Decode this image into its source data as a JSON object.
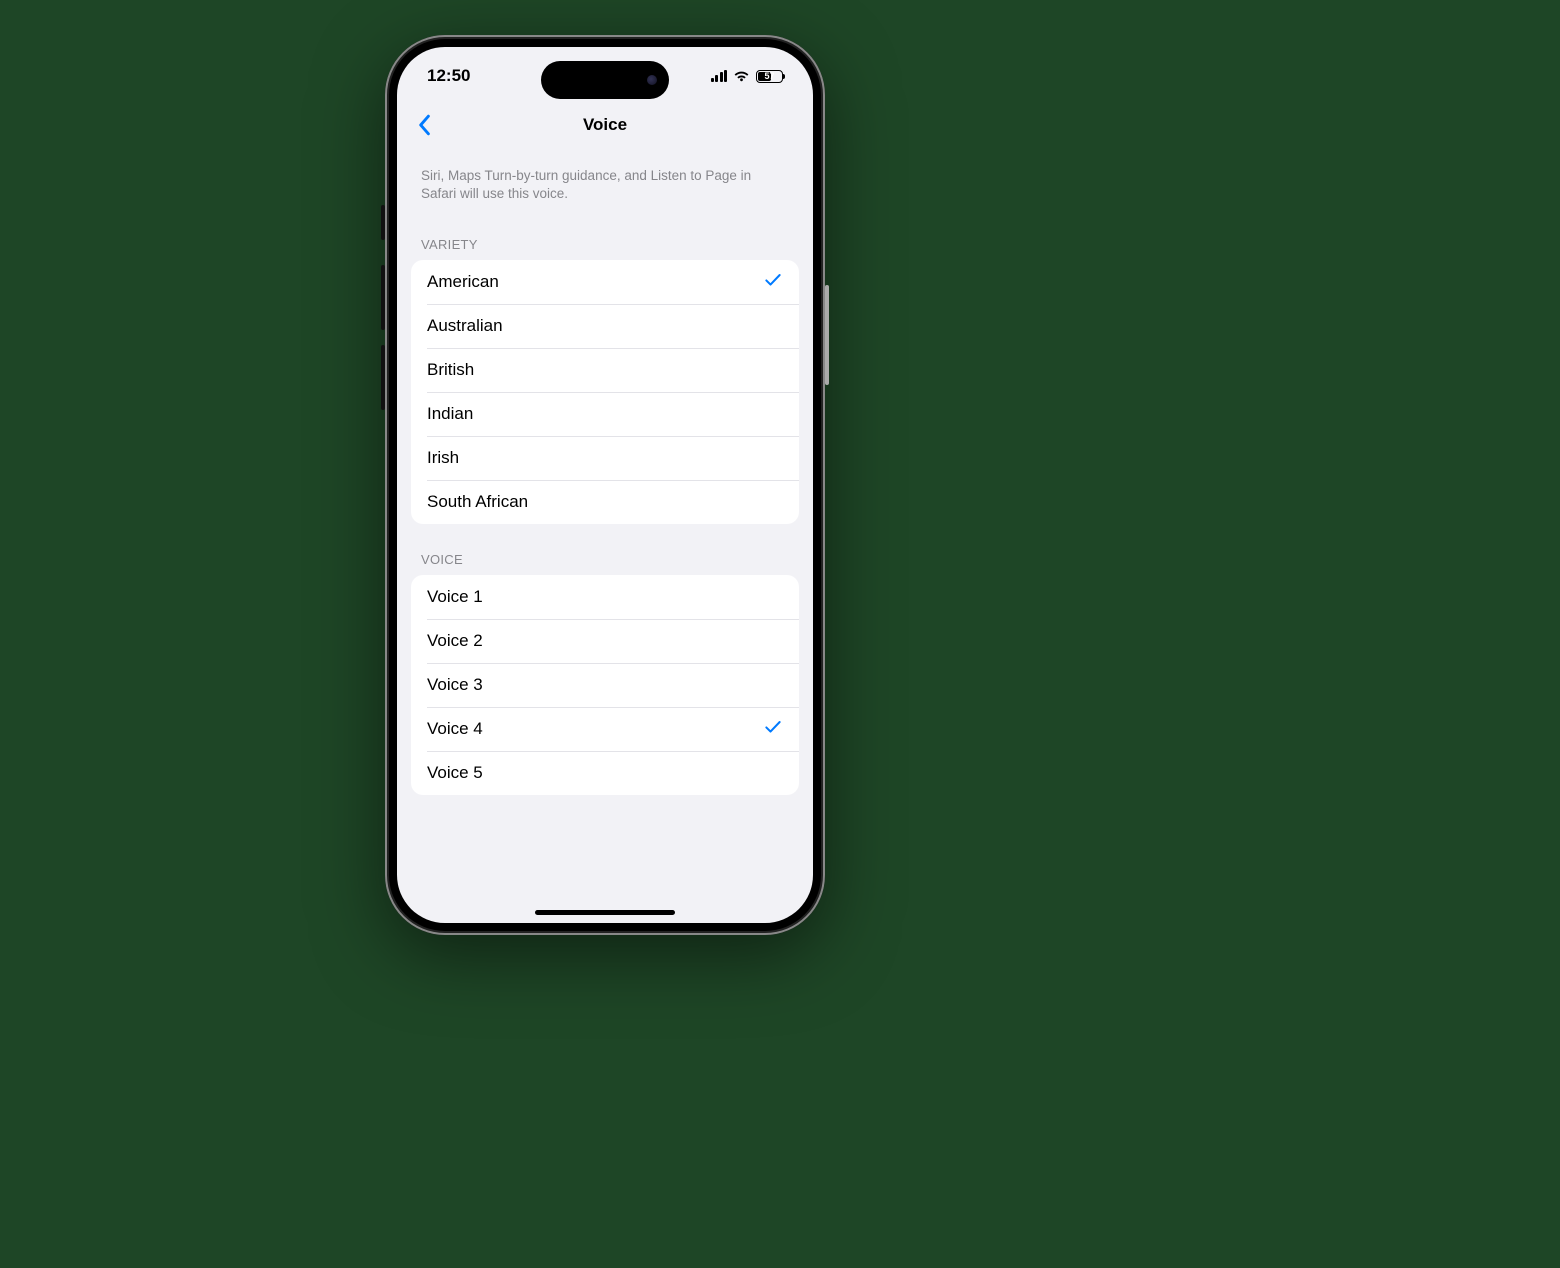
{
  "status": {
    "time": "12:50",
    "battery_percent": 57,
    "battery_label": "57"
  },
  "nav": {
    "title": "Voice"
  },
  "description": "Siri, Maps Turn-by-turn guidance, and Listen to Page in Safari will use this voice.",
  "sections": {
    "variety": {
      "header": "VARIETY",
      "items": [
        {
          "label": "American",
          "selected": true
        },
        {
          "label": "Australian",
          "selected": false
        },
        {
          "label": "British",
          "selected": false
        },
        {
          "label": "Indian",
          "selected": false
        },
        {
          "label": "Irish",
          "selected": false
        },
        {
          "label": "South African",
          "selected": false
        }
      ]
    },
    "voice": {
      "header": "VOICE",
      "items": [
        {
          "label": "Voice 1",
          "selected": false
        },
        {
          "label": "Voice 2",
          "selected": false
        },
        {
          "label": "Voice 3",
          "selected": false
        },
        {
          "label": "Voice 4",
          "selected": true
        },
        {
          "label": "Voice 5",
          "selected": false
        }
      ]
    }
  }
}
